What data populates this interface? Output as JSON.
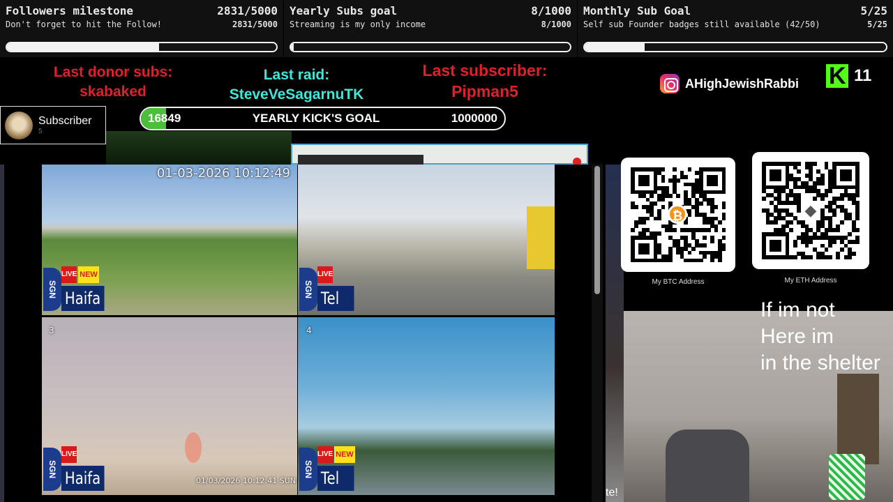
{
  "goals": [
    {
      "title": "Followers milestone",
      "count": "2831/5000",
      "subtitle": "Don't forget to hit the Follow!",
      "progress": 0.566
    },
    {
      "title": "Yearly Subs goal",
      "count": "8/1000",
      "subtitle": "Streaming is my only income",
      "progress": 0.008
    },
    {
      "title": "Monthly Sub Goal",
      "count": "5/25",
      "subtitle": "Self sub Founder badges still available (42/50)",
      "progress": 0.2
    }
  ],
  "alerts": {
    "donor_label": "Last donor subs:",
    "donor_name": "skabaked",
    "raid_label": "Last raid:",
    "raid_name": "SteveVeSagarnuTK",
    "sub_label": "Last subscriber:",
    "sub_name": "Pipman5"
  },
  "social": {
    "instagram_icon": "instagram-icon",
    "handle": "AHighJewishRabbi",
    "kick_icon": "kick-logo-icon",
    "kick_count": "11"
  },
  "subscriber_card": {
    "title": "Subscriber",
    "count": "5"
  },
  "kick_goal": {
    "current": "16849",
    "label": "YEARLY KICK'S GOAL",
    "target": "1000000",
    "progress": 0.016849
  },
  "cameras": [
    {
      "timestamp": "01-03-2026 10:12:49",
      "live": "LIVE",
      "new": "NEW",
      "city": "Haifa",
      "logo": "SGN"
    },
    {
      "timestamp": "",
      "live": "LIVE",
      "new": "",
      "city": "Tel Aviv",
      "logo": "SGN"
    },
    {
      "timestamp": "01/03/2026 10:12:41 SUN",
      "index": "3",
      "live": "LIVE",
      "new": "",
      "city": "Haifa",
      "logo": "SGN"
    },
    {
      "timestamp": "",
      "index": "4",
      "live": "LIVE",
      "new": "NEW",
      "city": "Tel Aviv",
      "logo": "SGN"
    }
  ],
  "wallets": {
    "btc_label": "My BTC Address",
    "eth_label": "My ETH Address"
  },
  "overlay_text": {
    "shelter": "If im not\nHere im\nin the shelter",
    "side_fragment": "te!"
  },
  "colors": {
    "alert_red": "#e0202c",
    "alert_cyan": "#3fe8d8",
    "kick_green": "#53fc18",
    "goal_fill": "#f2f2f2"
  }
}
